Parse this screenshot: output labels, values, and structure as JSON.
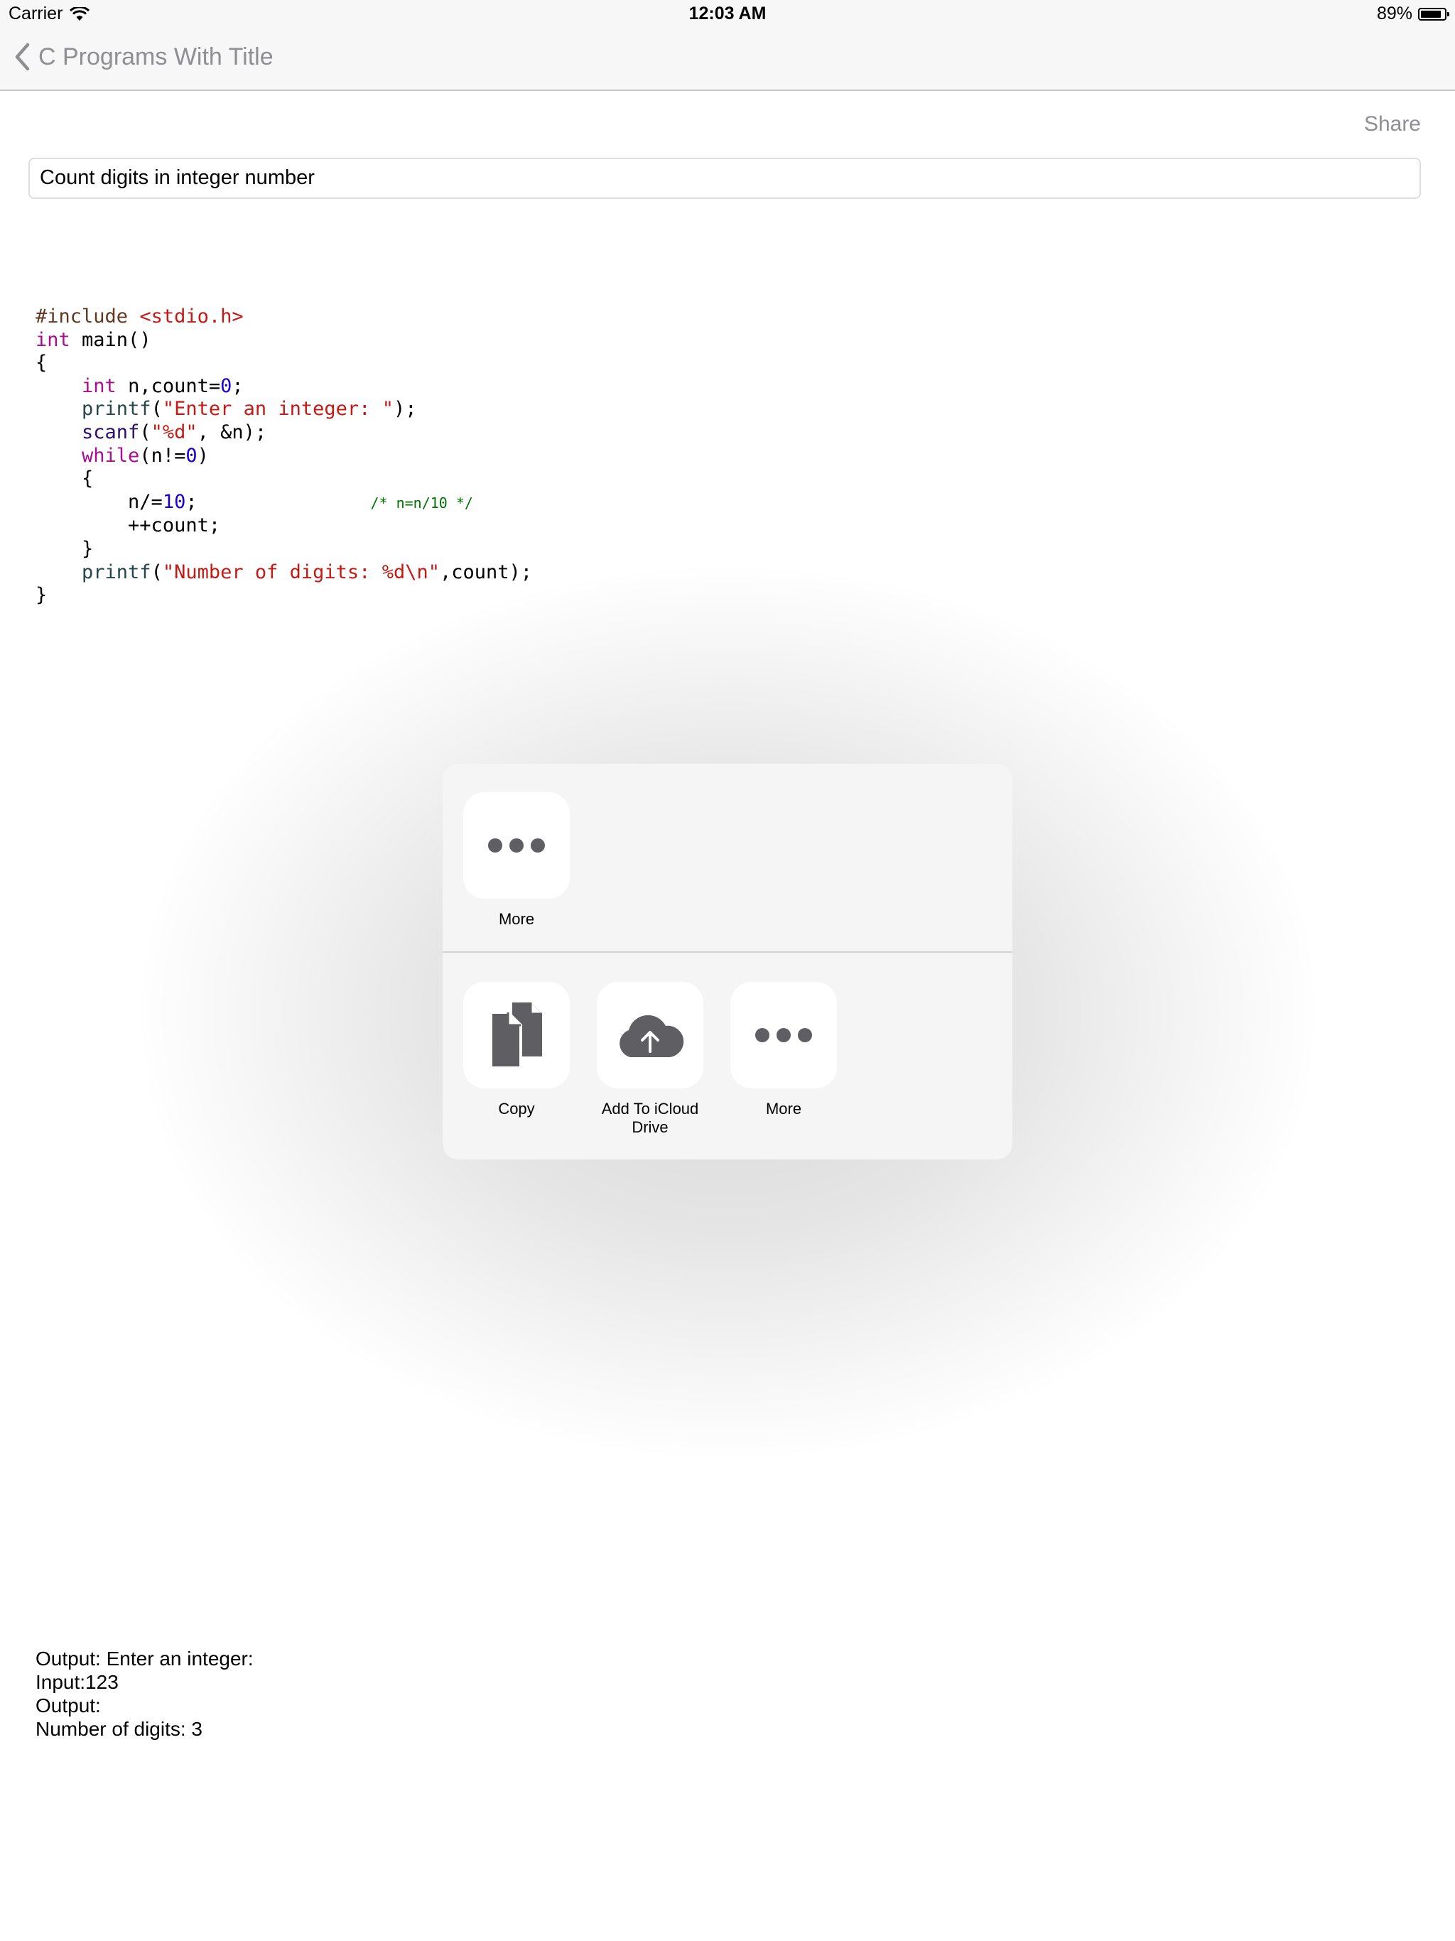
{
  "status_bar": {
    "carrier": "Carrier",
    "time": "12:03 AM",
    "battery_text": "89%",
    "battery_level": 0.89
  },
  "nav": {
    "back_label": "C Programs With Title"
  },
  "share_label": "Share",
  "title_field": {
    "value": "Count digits in integer number"
  },
  "code": {
    "l1_a": "#include ",
    "l1_b": "<stdio.h>",
    "l2_a": "int",
    "l2_b": " main()",
    "l3": "{",
    "l4_a": "int",
    "l4_b": " n,count=",
    "l4_c": "0",
    "l4_d": ";",
    "l5_a": "printf",
    "l5_b": "(",
    "l5_c": "\"Enter an integer: \"",
    "l5_d": ");",
    "l6_a": "scanf",
    "l6_b": "(",
    "l6_c": "\"%d\"",
    "l6_d": ", &n);",
    "l7_a": "while",
    "l7_b": "(n!=",
    "l7_c": "0",
    "l7_d": ")",
    "l8": "{",
    "l9_a": "n/=",
    "l9_b": "10",
    "l9_c": ";",
    "l9_d": "/* n=n/10 */",
    "l10": "++count;",
    "l11": "}",
    "l12_a": "printf",
    "l12_b": "(",
    "l12_c": "\"Number of digits: %d\\n\"",
    "l12_d": ",count);",
    "l13": "}"
  },
  "output": {
    "line1": "Output: Enter an integer:",
    "line2": "Input:123",
    "line3": "Output:",
    "line4": "Number of digits: 3"
  },
  "share_sheet": {
    "row1": [
      {
        "label": "More",
        "icon": "more-icon"
      }
    ],
    "row2": [
      {
        "label": "Copy",
        "icon": "copy-icon"
      },
      {
        "label": "Add To iCloud Drive",
        "icon": "icloud-upload-icon"
      },
      {
        "label": "More",
        "icon": "more-icon"
      }
    ]
  },
  "colors": {
    "nav_bg": "#f7f7f7",
    "gray_text": "#8e8e93",
    "icon_gray": "#5e5e63",
    "sheet_bg": "#f5f5f5"
  }
}
